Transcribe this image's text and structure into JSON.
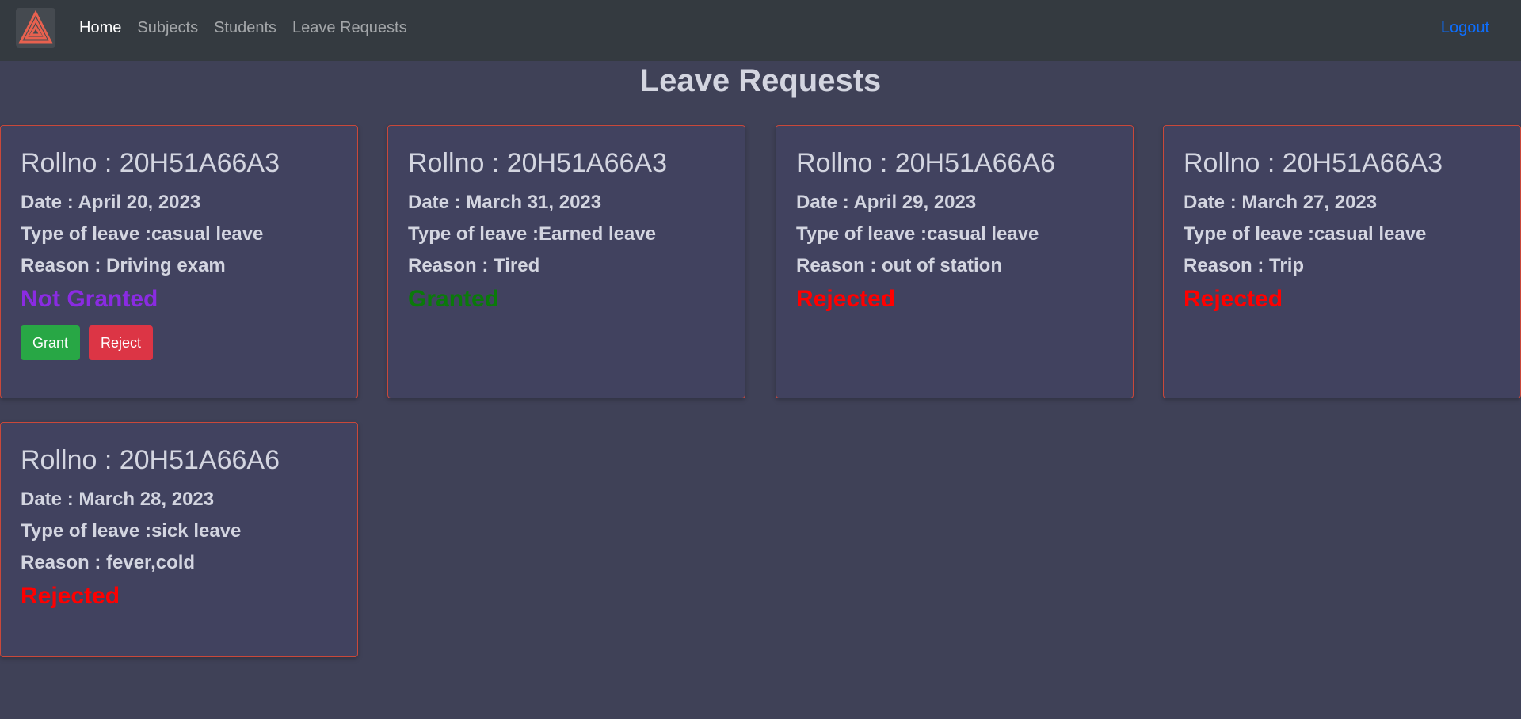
{
  "nav": {
    "links": [
      "Home",
      "Subjects",
      "Students",
      "Leave Requests"
    ],
    "logout": "Logout"
  },
  "page": {
    "title": "Leave Requests"
  },
  "cards": [
    {
      "roll": "Rollno : 20H51A66A3",
      "date": "Date : April 20, 2023",
      "type": "Type of leave :casual leave",
      "reason": "Reason : Driving exam",
      "status": "Not Granted",
      "grant_label": "Grant",
      "reject_label": "Reject"
    },
    {
      "roll": "Rollno : 20H51A66A3",
      "date": "Date : March 31, 2023",
      "type": "Type of leave :Earned leave",
      "reason": "Reason : Tired",
      "status": "Granted"
    },
    {
      "roll": "Rollno : 20H51A66A6",
      "date": "Date : April 29, 2023",
      "type": "Type of leave :casual leave",
      "reason": "Reason : out of station",
      "status": "Rejected"
    },
    {
      "roll": "Rollno : 20H51A66A3",
      "date": "Date : March 27, 2023",
      "type": "Type of leave :casual leave",
      "reason": "Reason : Trip",
      "status": "Rejected"
    },
    {
      "roll": "Rollno : 20H51A66A6",
      "date": "Date : March 28, 2023",
      "type": "Type of leave :sick leave",
      "reason": "Reason : fever,cold",
      "status": "Rejected"
    }
  ],
  "colors": {
    "navbar": "#343a40",
    "background": "#3f4157",
    "card_border": "#c9483a",
    "not_granted": "#8a2be2",
    "granted": "#0a7a0a",
    "rejected": "#ff0000",
    "grant_button": "#28a745",
    "reject_button": "#dc3545",
    "logout": "#0d6efd"
  },
  "icons": {
    "brand": "triangle-logo-icon"
  }
}
